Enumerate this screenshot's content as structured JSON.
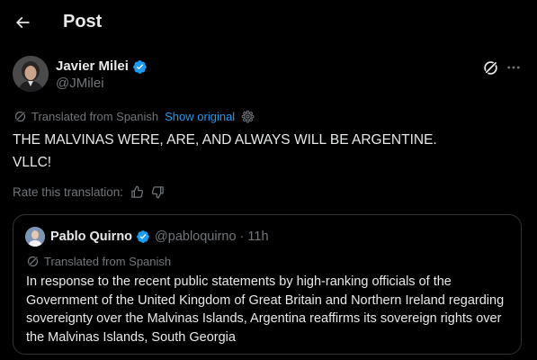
{
  "header": {
    "back_icon": "arrow-left-icon",
    "title": "Post"
  },
  "post": {
    "author": {
      "name": "Javier Milei",
      "handle": "@JMilei",
      "verified": true,
      "verified_color": "#1d9bf0"
    },
    "translation_label": "Translated from Spanish",
    "show_original": "Show original",
    "text_lines": [
      "THE MALVINAS WERE, ARE, AND ALWAYS WILL BE ARGENTINE.",
      "VLLC!"
    ],
    "rate_label": "Rate this translation:"
  },
  "quote": {
    "author_name": "Pablo Quirno",
    "handle": "@pabloquirno",
    "separator": "·",
    "time": "11h",
    "verified": true,
    "translation_label": "Translated from Spanish",
    "text": "In response to the recent public statements by high-ranking officials of the Government of the United Kingdom of Great Britain and Northern Ireland regarding sovereignty over the Malvinas Islands, Argentina reaffirms its sovereign rights over the Malvinas Islands, South Georgia"
  },
  "colors": {
    "background": "#000000",
    "text_primary": "#e7e9ea",
    "text_secondary": "#71767b",
    "accent": "#1d9bf0",
    "border": "#2f3336"
  }
}
